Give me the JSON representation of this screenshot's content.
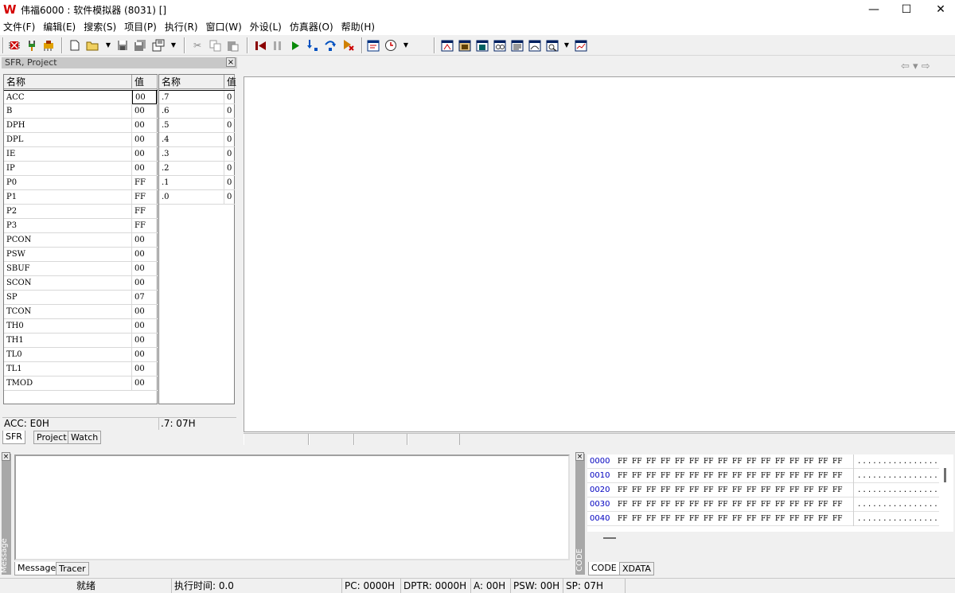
{
  "window": {
    "title": "伟福6000 : 软件模拟器 (8031) []",
    "logo_glyph": "W",
    "minimize": "—",
    "maximize": "☐",
    "close": "✕"
  },
  "menu": [
    "文件(F)",
    "编辑(E)",
    "搜索(S)",
    "项目(P)",
    "执行(R)",
    "窗口(W)",
    "外设(L)",
    "仿真器(O)",
    "帮助(H)"
  ],
  "toolbar": {
    "icons": [
      "chip-icon",
      "plug-icon",
      "chip-config-icon",
      "new-file-icon",
      "open-folder-icon",
      "save-icon",
      "save-all-icon",
      "project-icon",
      "cut-icon",
      "copy-icon",
      "paste-icon",
      "reset-icon",
      "pause-icon",
      "run-icon",
      "step-into-icon",
      "step-over-icon",
      "run-to-cursor-icon",
      "window-icon",
      "clock-icon",
      "reg-window-icon",
      "mem-window-icon",
      "data-window-icon",
      "watch-window-icon",
      "code-window-icon",
      "io-window-icon",
      "trace-window-icon",
      "chart-window-icon"
    ]
  },
  "sfr_panel": {
    "title": "SFR, Project",
    "close": "×",
    "headers": {
      "name": "名称",
      "value": "值",
      "bit_name": "名称",
      "bit_value": "值"
    },
    "registers": [
      {
        "name": "ACC",
        "value": "00"
      },
      {
        "name": "B",
        "value": "00"
      },
      {
        "name": "DPH",
        "value": "00"
      },
      {
        "name": "DPL",
        "value": "00"
      },
      {
        "name": "IE",
        "value": "00"
      },
      {
        "name": "IP",
        "value": "00"
      },
      {
        "name": "P0",
        "value": "FF"
      },
      {
        "name": "P1",
        "value": "FF"
      },
      {
        "name": "P2",
        "value": "FF"
      },
      {
        "name": "P3",
        "value": "FF"
      },
      {
        "name": "PCON",
        "value": "00"
      },
      {
        "name": "PSW",
        "value": "00"
      },
      {
        "name": "SBUF",
        "value": "00"
      },
      {
        "name": "SCON",
        "value": "00"
      },
      {
        "name": "SP",
        "value": "07"
      },
      {
        "name": "TCON",
        "value": "00"
      },
      {
        "name": "TH0",
        "value": "00"
      },
      {
        "name": "TH1",
        "value": "00"
      },
      {
        "name": "TL0",
        "value": "00"
      },
      {
        "name": "TL1",
        "value": "00"
      },
      {
        "name": "TMOD",
        "value": "00"
      }
    ],
    "bits": [
      {
        "name": ".7",
        "value": "0"
      },
      {
        "name": ".6",
        "value": "0"
      },
      {
        "name": ".5",
        "value": "0"
      },
      {
        "name": ".4",
        "value": "0"
      },
      {
        "name": ".3",
        "value": "0"
      },
      {
        "name": ".2",
        "value": "0"
      },
      {
        "name": ".1",
        "value": "0"
      },
      {
        "name": ".0",
        "value": "0"
      }
    ],
    "status_left": "ACC: E0H",
    "status_right": ".7: 07H",
    "tabs": [
      "SFR",
      "Project",
      "Watch"
    ]
  },
  "main_nav": {
    "back": "⇦",
    "dropdown": "▾",
    "forward": "⇨"
  },
  "message_panel": {
    "vertical_label": "Message",
    "close": "×",
    "tabs": [
      "Message",
      "Tracer"
    ]
  },
  "code_panel": {
    "vertical_label": "CODE",
    "close": "×",
    "rows": [
      {
        "addr": "0000",
        "bytes": [
          "FF",
          "FF",
          "FF",
          "FF",
          "FF",
          "FF",
          "FF",
          "FF",
          "FF",
          "FF",
          "FF",
          "FF",
          "FF",
          "FF",
          "FF",
          "FF"
        ],
        "ascii": "................"
      },
      {
        "addr": "0010",
        "bytes": [
          "FF",
          "FF",
          "FF",
          "FF",
          "FF",
          "FF",
          "FF",
          "FF",
          "FF",
          "FF",
          "FF",
          "FF",
          "FF",
          "FF",
          "FF",
          "FF"
        ],
        "ascii": "................"
      },
      {
        "addr": "0020",
        "bytes": [
          "FF",
          "FF",
          "FF",
          "FF",
          "FF",
          "FF",
          "FF",
          "FF",
          "FF",
          "FF",
          "FF",
          "FF",
          "FF",
          "FF",
          "FF",
          "FF"
        ],
        "ascii": "................"
      },
      {
        "addr": "0030",
        "bytes": [
          "FF",
          "FF",
          "FF",
          "FF",
          "FF",
          "FF",
          "FF",
          "FF",
          "FF",
          "FF",
          "FF",
          "FF",
          "FF",
          "FF",
          "FF",
          "FF"
        ],
        "ascii": "................"
      },
      {
        "addr": "0040",
        "bytes": [
          "FF",
          "FF",
          "FF",
          "FF",
          "FF",
          "FF",
          "FF",
          "FF",
          "FF",
          "FF",
          "FF",
          "FF",
          "FF",
          "FF",
          "FF",
          "FF"
        ],
        "ascii": "................"
      }
    ],
    "tabs": [
      "CODE",
      "XDATA"
    ]
  },
  "statusbar": {
    "ready": "就绪",
    "exec_time": "执行时间: 0.0",
    "pc": "PC: 0000H",
    "dptr": "DPTR: 0000H",
    "a": "A: 00H",
    "psw": "PSW: 00H",
    "sp": "SP: 07H"
  }
}
